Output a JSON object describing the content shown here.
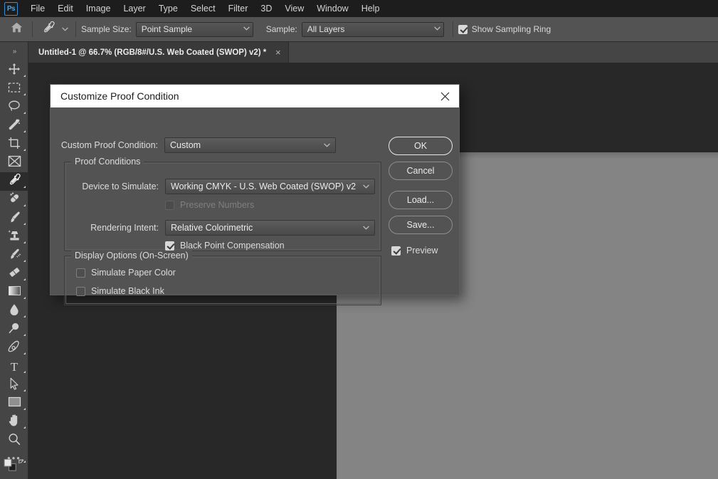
{
  "app": {
    "name": "Ps",
    "accent": "#3d8fd0"
  },
  "menubar": {
    "items": [
      {
        "label": "File"
      },
      {
        "label": "Edit"
      },
      {
        "label": "Image"
      },
      {
        "label": "Layer"
      },
      {
        "label": "Type"
      },
      {
        "label": "Select"
      },
      {
        "label": "Filter"
      },
      {
        "label": "3D"
      },
      {
        "label": "View"
      },
      {
        "label": "Window"
      },
      {
        "label": "Help"
      }
    ]
  },
  "optionsbar": {
    "home_icon": "home-icon",
    "tool_icon": "eyedropper-icon",
    "sample_size_label": "Sample Size:",
    "sample_size_value": "Point Sample",
    "sample_label": "Sample:",
    "sample_value": "All Layers",
    "show_sampling_ring_label": "Show Sampling Ring",
    "show_sampling_ring_checked": true
  },
  "tabbar": {
    "overflow_glyph": "»",
    "document_title": "Untitled-1 @ 66.7% (RGB/8#/U.S. Web Coated (SWOP) v2) *",
    "close_glyph": "×"
  },
  "toolbar": {
    "tools": [
      {
        "name": "move-tool",
        "icon": "move-icon",
        "active": false,
        "corner": true
      },
      {
        "name": "rectangular-marquee-tool",
        "icon": "marquee-icon",
        "active": false,
        "corner": true
      },
      {
        "name": "lasso-tool",
        "icon": "lasso-icon",
        "active": false,
        "corner": true
      },
      {
        "name": "object-selection-tool",
        "icon": "magic-wand-icon",
        "active": false,
        "corner": true
      },
      {
        "name": "crop-tool",
        "icon": "crop-icon",
        "active": false,
        "corner": true
      },
      {
        "name": "frame-tool",
        "icon": "frame-icon",
        "active": false,
        "corner": false
      },
      {
        "name": "eyedropper-tool",
        "icon": "eyedropper-icon",
        "active": true,
        "corner": true
      },
      {
        "name": "spot-healing-brush-tool",
        "icon": "healing-brush-icon",
        "active": false,
        "corner": true
      },
      {
        "name": "brush-tool",
        "icon": "brush-icon",
        "active": false,
        "corner": true
      },
      {
        "name": "clone-stamp-tool",
        "icon": "clone-stamp-icon",
        "active": false,
        "corner": true
      },
      {
        "name": "history-brush-tool",
        "icon": "history-brush-icon",
        "active": false,
        "corner": true
      },
      {
        "name": "eraser-tool",
        "icon": "eraser-icon",
        "active": false,
        "corner": true
      },
      {
        "name": "gradient-tool",
        "icon": "gradient-icon",
        "active": false,
        "corner": true
      },
      {
        "name": "blur-tool",
        "icon": "blur-droplet-icon",
        "active": false,
        "corner": true
      },
      {
        "name": "dodge-tool",
        "icon": "dodge-icon",
        "active": false,
        "corner": true
      },
      {
        "name": "pen-tool",
        "icon": "pen-icon",
        "active": false,
        "corner": true
      },
      {
        "name": "type-tool",
        "icon": "type-icon",
        "active": false,
        "corner": true
      },
      {
        "name": "path-selection-tool",
        "icon": "path-selection-arrow-icon",
        "active": false,
        "corner": true
      },
      {
        "name": "rectangle-tool",
        "icon": "rectangle-icon",
        "active": false,
        "corner": true
      },
      {
        "name": "hand-tool",
        "icon": "hand-icon",
        "active": false,
        "corner": true
      },
      {
        "name": "zoom-tool",
        "icon": "zoom-magnifier-icon",
        "active": false,
        "corner": false
      }
    ],
    "more_tools_glyph": "•••",
    "foreground_color": "#e8e8e8",
    "background_color": "#1d1d1d"
  },
  "dialog": {
    "title": "Customize Proof Condition",
    "close_glyph": "×",
    "custom_proof_condition_label": "Custom Proof Condition:",
    "custom_proof_condition_value": "Custom",
    "proof_conditions_legend": "Proof Conditions",
    "device_to_simulate_label": "Device to Simulate:",
    "device_to_simulate_value": "Working CMYK - U.S. Web Coated (SWOP) v2",
    "preserve_numbers_label": "Preserve Numbers",
    "preserve_numbers_checked": false,
    "preserve_numbers_disabled": true,
    "rendering_intent_label": "Rendering Intent:",
    "rendering_intent_value": "Relative Colorimetric",
    "black_point_compensation_label": "Black Point Compensation",
    "black_point_compensation_checked": true,
    "display_options_legend": "Display Options (On-Screen)",
    "simulate_paper_color_label": "Simulate Paper Color",
    "simulate_paper_color_checked": false,
    "simulate_black_ink_label": "Simulate Black Ink",
    "simulate_black_ink_checked": false,
    "buttons": {
      "ok": "OK",
      "cancel": "Cancel",
      "load": "Load...",
      "save": "Save..."
    },
    "preview_label": "Preview",
    "preview_checked": true
  }
}
